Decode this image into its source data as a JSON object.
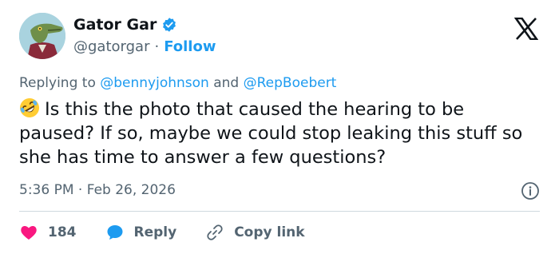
{
  "author": {
    "display_name": "Gator Gar",
    "handle": "@gatorgar",
    "separator": "·",
    "follow_label": "Follow"
  },
  "reply_context": {
    "prefix": "Replying to",
    "mention_1": "@bennyjohnson",
    "conjunction": "and",
    "mention_2": "@RepBoebert"
  },
  "tweet": {
    "text": "Is this the photo that caused the hearing to be paused? If so, maybe we could stop leaking this stuff so she has time to answer a few questions?",
    "emoji": "rolling-on-floor-laughing"
  },
  "meta": {
    "time": "5:36 PM",
    "separator": "·",
    "date": "Feb 26, 2026"
  },
  "actions": {
    "like_count": "184",
    "reply_label": "Reply",
    "copy_label": "Copy link"
  },
  "colors": {
    "accent": "#1d9bf0",
    "like": "#f91880",
    "text": "#0f1419",
    "muted": "#536471"
  },
  "icons": [
    "verified-badge-icon",
    "x-logo-icon",
    "info-icon",
    "heart-icon",
    "reply-bubble-icon",
    "link-icon"
  ]
}
